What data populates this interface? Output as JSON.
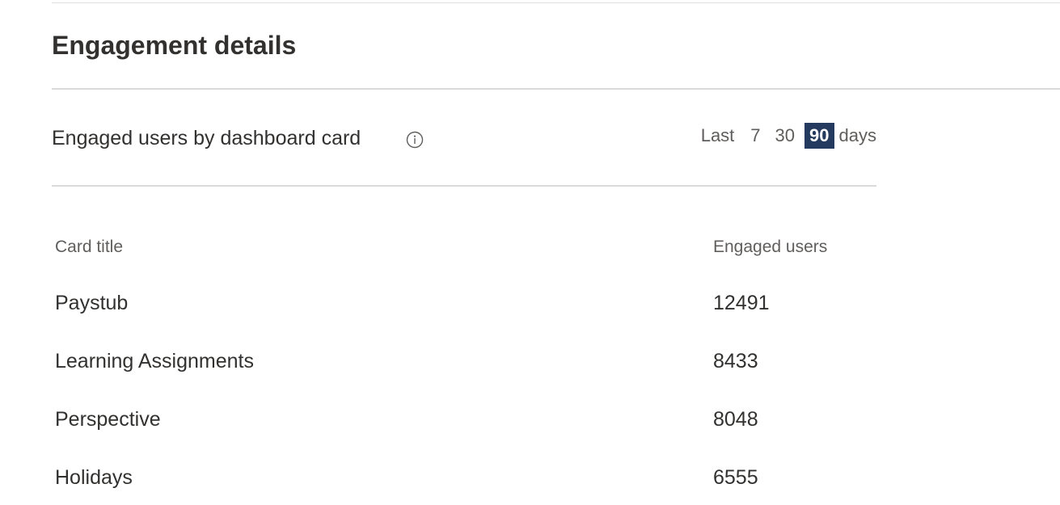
{
  "section": {
    "title": "Engagement details"
  },
  "card": {
    "title": "Engaged users by dashboard card",
    "info_icon": "info-circle-icon"
  },
  "range": {
    "prefix": "Last",
    "options": [
      "7",
      "30",
      "90"
    ],
    "selected": "90",
    "unit": "days"
  },
  "table": {
    "columns": [
      "Card title",
      "Engaged users"
    ],
    "rows": [
      {
        "title": "Paystub",
        "users": "12491"
      },
      {
        "title": "Learning Assignments",
        "users": "8433"
      },
      {
        "title": "Perspective",
        "users": "8048"
      },
      {
        "title": "Holidays",
        "users": "6555"
      }
    ]
  },
  "colors": {
    "selected_bg": "#243a5e",
    "text": "#323130",
    "muted": "#605e5c",
    "divider": "#dadada"
  }
}
